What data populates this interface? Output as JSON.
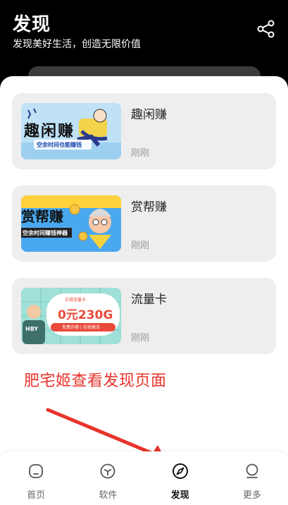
{
  "header": {
    "title": "发现",
    "subtitle": "发现美好生活，创造无限价值"
  },
  "cards": [
    {
      "name": "趣闲赚",
      "time": "刚刚",
      "thumb_text": "趣闲赚",
      "thumb_sub": "空余时间也能赚钱"
    },
    {
      "name": "赏帮赚",
      "time": "刚刚",
      "thumb_text": "赏帮赚",
      "thumb_sub": "空余时间赚钱神器"
    },
    {
      "name": "流量卡",
      "time": "刚刚",
      "thumb_top": "正规流量卡",
      "thumb_text": "0元230G",
      "thumb_sub": "免费办理 | 在线激活",
      "thumb_shirt": "HBY"
    }
  ],
  "annotation": "肥宅姬查看发现页面",
  "tabbar": {
    "tabs": [
      {
        "label": "首页",
        "icon": "home-icon"
      },
      {
        "label": "软件",
        "icon": "cube-icon"
      },
      {
        "label": "发现",
        "icon": "compass-icon",
        "active": true
      },
      {
        "label": "更多",
        "icon": "profile-icon"
      }
    ]
  },
  "colors": {
    "accent_red": "#e8332b",
    "card_bg": "#eeeeee",
    "header_bg": "#000000"
  }
}
